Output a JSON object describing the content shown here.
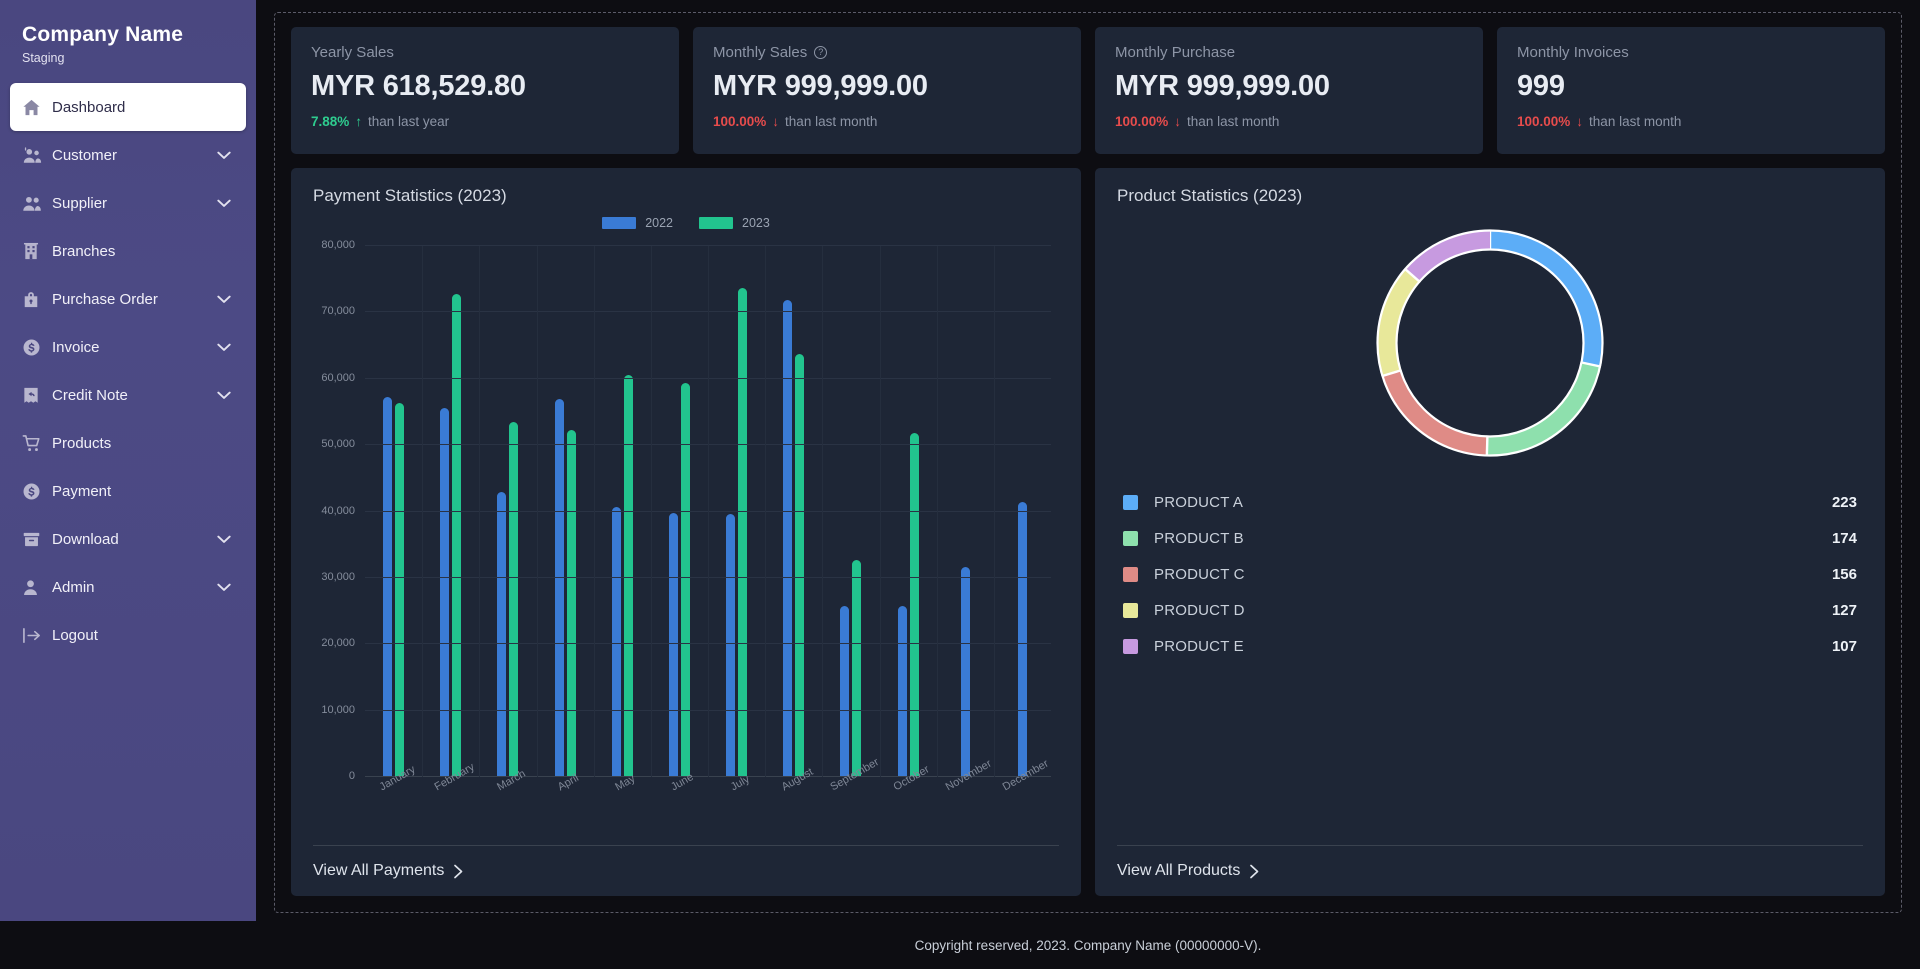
{
  "sidebar": {
    "brand_title": "Company Name",
    "brand_subtitle": "Staging",
    "items": [
      {
        "label": "Dashboard",
        "icon": "home-icon",
        "active": true,
        "chevron": false
      },
      {
        "label": "Customer",
        "icon": "customers-icon",
        "active": false,
        "chevron": true
      },
      {
        "label": "Supplier",
        "icon": "supplier-icon",
        "active": false,
        "chevron": true
      },
      {
        "label": "Branches",
        "icon": "building-icon",
        "active": false,
        "chevron": false
      },
      {
        "label": "Purchase Order",
        "icon": "bag-lock-icon",
        "active": false,
        "chevron": true
      },
      {
        "label": "Invoice",
        "icon": "dollar-circle-icon",
        "active": false,
        "chevron": true
      },
      {
        "label": "Credit Note",
        "icon": "credit-note-icon",
        "active": false,
        "chevron": true
      },
      {
        "label": "Products",
        "icon": "cart-icon",
        "active": false,
        "chevron": false
      },
      {
        "label": "Payment",
        "icon": "dollar-circle-icon",
        "active": false,
        "chevron": false
      },
      {
        "label": "Download",
        "icon": "archive-icon",
        "active": false,
        "chevron": true
      },
      {
        "label": "Admin",
        "icon": "person-icon",
        "active": false,
        "chevron": true
      },
      {
        "label": "Logout",
        "icon": "logout-icon",
        "active": false,
        "chevron": false
      }
    ]
  },
  "kpis": [
    {
      "label": "Yearly Sales",
      "info": false,
      "value": "MYR 618,529.80",
      "pct": "7.88%",
      "dir": "up",
      "arrow": "↑",
      "note": "than last year"
    },
    {
      "label": "Monthly Sales",
      "info": true,
      "value": "MYR 999,999.00",
      "pct": "100.00%",
      "dir": "down",
      "arrow": "↓",
      "note": "than last month"
    },
    {
      "label": "Monthly Purchase",
      "info": false,
      "value": "MYR 999,999.00",
      "pct": "100.00%",
      "dir": "down",
      "arrow": "↓",
      "note": "than last month"
    },
    {
      "label": "Monthly Invoices",
      "info": false,
      "value": "999",
      "pct": "100.00%",
      "dir": "down",
      "arrow": "↓",
      "note": "than last month"
    }
  ],
  "payment_panel": {
    "title": "Payment Statistics (2023)",
    "view_all_label": "View All Payments"
  },
  "product_panel": {
    "title": "Product Statistics (2023)",
    "view_all_label": "View All Products"
  },
  "footer": {
    "text": "Copyright reserved, 2023. Company Name (00000000-V)."
  },
  "colors": {
    "series_2022": "#3a7bd5",
    "series_2023": "#22c48e",
    "product_a": "#5cadf7",
    "product_b": "#8ee0ad",
    "product_c": "#df8b86",
    "product_d": "#e8e89a",
    "product_e": "#c79ae0",
    "up": "#2ecc8f",
    "down": "#e74c4c",
    "sidebar": "#4a4780",
    "panel": "#1e2636",
    "page": "#0d0d12"
  },
  "chart_data": [
    {
      "type": "bar",
      "title": "Payment Statistics (2023)",
      "xlabel": "",
      "ylabel": "",
      "ylim": [
        0,
        80000
      ],
      "yticks": [
        0,
        10000,
        20000,
        30000,
        40000,
        50000,
        60000,
        70000,
        80000
      ],
      "ytick_labels": [
        "0",
        "10,000",
        "20,000",
        "30,000",
        "40,000",
        "50,000",
        "60,000",
        "70,000",
        "80,000"
      ],
      "grid": true,
      "legend_position": "top-center",
      "categories": [
        "January",
        "February",
        "March",
        "April",
        "May",
        "June",
        "July",
        "August",
        "September",
        "October",
        "November",
        "December"
      ],
      "series": [
        {
          "name": "2022",
          "color": "#3a7bd5",
          "values": [
            57200,
            55600,
            43000,
            57000,
            40700,
            39800,
            39700,
            71800,
            25800,
            25800,
            31600,
            41500
          ]
        },
        {
          "name": "2023",
          "color": "#22c48e",
          "values": [
            56400,
            72700,
            53500,
            52300,
            60500,
            59300,
            73600,
            63700,
            32700,
            51800,
            0,
            0
          ]
        }
      ]
    },
    {
      "type": "pie",
      "title": "Product Statistics (2023)",
      "donut": true,
      "legend_position": "bottom",
      "labels": [
        "PRODUCT A",
        "PRODUCT B",
        "PRODUCT C",
        "PRODUCT D",
        "PRODUCT E"
      ],
      "values": [
        223,
        174,
        156,
        127,
        107
      ],
      "colors": [
        "#5cadf7",
        "#8ee0ad",
        "#df8b86",
        "#e8e89a",
        "#c79ae0"
      ]
    }
  ]
}
